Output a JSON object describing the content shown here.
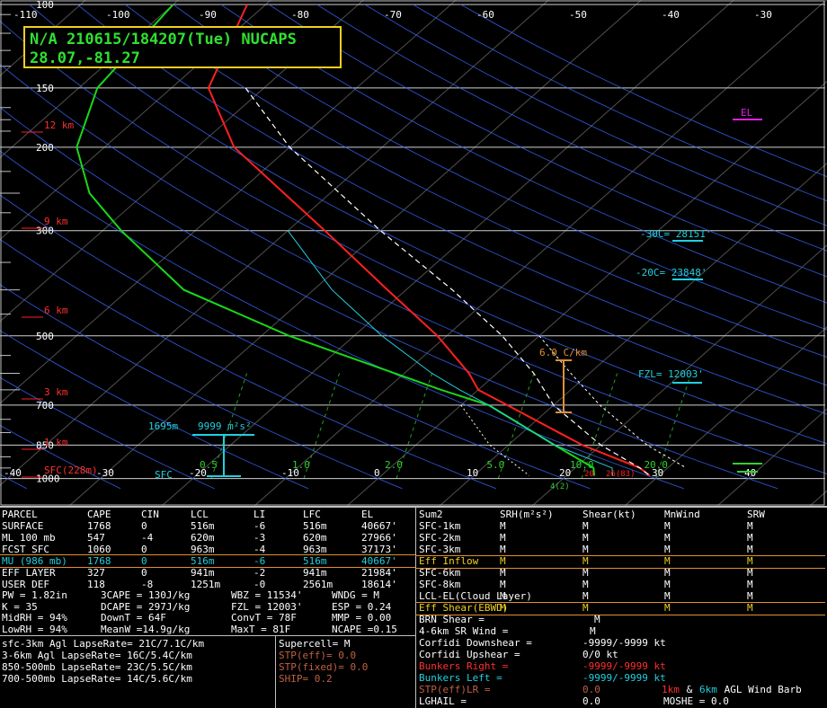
{
  "title": {
    "line1": "N/A 210615/184207(Tue) NUCAPS",
    "line2": "28.07,-81.27"
  },
  "colors": {
    "temp": "#ff2020",
    "dew": "#18d818",
    "isobar": "#ffffff",
    "isotherm": "#3a66ff",
    "parcel": "#ffffff",
    "cyan": "#20d0e0",
    "orange": "#e09030",
    "magenta": "#e020e0",
    "green": "#30d030"
  },
  "chart_data": {
    "type": "skew-t",
    "temp_ticks_top": [
      "-110",
      "-100",
      "-90",
      "-80",
      "-70",
      "-60",
      "-50",
      "-40",
      "-30"
    ],
    "temp_ticks_bottom": [
      "-40",
      "-30",
      "-20",
      "-10",
      "0",
      "10",
      "20",
      "30",
      "40"
    ],
    "pressure_labels": [
      "100",
      "150",
      "200",
      "300",
      "500",
      "700",
      "850",
      "1000"
    ],
    "height_labels": [
      "12 km",
      "9 km",
      "6 km",
      "3 km",
      "1 km",
      "SFC(228m)"
    ],
    "mixing_ratio_labels": [
      "0.5",
      "1.0",
      "2.0",
      "5.0",
      "10.0",
      "20.0"
    ],
    "temperature_profile_pressure_hPa": [
      100,
      150,
      200,
      250,
      300,
      400,
      500,
      600,
      650,
      700,
      850,
      950,
      986
    ],
    "temperature_profile_degC": [
      -72,
      -66,
      -56,
      -45,
      -36,
      -22,
      -11,
      -3,
      0,
      5,
      18,
      27,
      29
    ],
    "dewpoint_profile_pressure_hPa": [
      100,
      150,
      200,
      250,
      300,
      400,
      500,
      600,
      650,
      700,
      850,
      950,
      986
    ],
    "dewpoint_profile_degC": [
      -80,
      -78,
      -73,
      -66,
      -58,
      -44,
      -27,
      -11,
      -4,
      3,
      15,
      22,
      23
    ],
    "annotations": {
      "lapse": "6.0 C/km",
      "el": "EL",
      "m30": "-30C= 28151'",
      "m20": "-20C= 23848'",
      "fzl": "FZL= 12003'",
      "srh_height": "1695m",
      "srh": "9999 m²s²",
      "sfc": "SFC",
      "sfc_temp": "20",
      "sfc_dew": "26(83)",
      "sfc_vt": "4(2)"
    }
  },
  "parcel_table": {
    "headers": [
      "PARCEL",
      "CAPE",
      "CIN",
      "LCL",
      "LI",
      "LFC",
      "EL"
    ],
    "rows": [
      [
        "SURFACE",
        "1768",
        "0",
        "516m",
        "-6",
        "516m",
        "40667'"
      ],
      [
        "ML 100 mb",
        "547",
        "-4",
        "620m",
        "-3",
        "620m",
        "27966'"
      ],
      [
        "FCST SFC",
        "1060",
        "0",
        "963m",
        "-4",
        "963m",
        "37173'"
      ],
      [
        "MU (986 mb)",
        "1768",
        "0",
        "516m",
        "-6",
        "516m",
        "40667'"
      ],
      [
        "EFF LAYER",
        "327",
        "0",
        "941m",
        "-2",
        "941m",
        "21984'"
      ],
      [
        "USER DEF",
        "118",
        "-8",
        "1251m",
        "-0",
        "2561m",
        "18614'"
      ]
    ]
  },
  "indices": {
    "rows": [
      [
        "PW = 1.82in",
        "3CAPE = 130J/kg",
        "WBZ = 11534'",
        "WNDG = M"
      ],
      [
        "K = 35",
        "DCAPE = 297J/kg",
        "FZL = 12003'",
        "ESP = 0.24"
      ],
      [
        "MidRH = 94%",
        "DownT = 64F",
        "ConvT = 78F",
        "MMP = 0.00"
      ],
      [
        "LowRH = 94%",
        "MeanW =14.9g/kg",
        "MaxT = 81F",
        "NCAPE =0.15"
      ]
    ]
  },
  "lapse_rates": [
    "sfc-3km Agl LapseRate= 21C/7.1C/km",
    "3-6km Agl LapseRate= 16C/5.4C/km",
    "850-500mb LapseRate= 23C/5.5C/km",
    "700-500mb LapseRate= 14C/5.6C/km"
  ],
  "composite": {
    "supercell": "Supercell= M",
    "stp_eff": "STP(eff)= 0.0",
    "stp_fixed": "STP(fixed)= 0.0",
    "ship": "SHIP= 0.2"
  },
  "shear_table": {
    "headers": [
      "Sum2",
      "SRH(m²s²)",
      "Shear(kt)",
      "MnWind",
      "SRW"
    ],
    "rows": [
      [
        "SFC-1km",
        "M",
        "M",
        "M",
        "M"
      ],
      [
        "SFC-2km",
        "M",
        "M",
        "M",
        "M"
      ],
      [
        "SFC-3km",
        "M",
        "M",
        "M",
        "M"
      ],
      [
        "Eff Inflow",
        "M",
        "M",
        "M",
        "M"
      ],
      [
        "SFC-6km",
        "M",
        "M",
        "M",
        "M"
      ],
      [
        "SFC-8km",
        "M",
        "M",
        "M",
        "M"
      ],
      [
        "LCL-EL(Cloud Layer)",
        "M",
        "M",
        "M",
        "M"
      ],
      [
        "Eff Shear(EBWD)",
        "M",
        "M",
        "M",
        "M"
      ]
    ]
  },
  "motion": {
    "brn_label": "BRN Shear =",
    "brn_val": "M",
    "sr46_label": "4-6km SR Wind =",
    "sr46_val": "M",
    "cdown_label": "Corfidi Downshear =",
    "cdown_val": "-9999/-9999 kt",
    "cup_label": "Corfidi Upshear =",
    "cup_val": "0/0 kt",
    "bright_label": "Bunkers Right =",
    "bright_val": "-9999/-9999 kt",
    "bleft_label": "Bunkers Left =",
    "bleft_val": "-9999/-9999 kt",
    "stplr_label": "STP(eff)LR =",
    "stplr_val": "0.0",
    "lghail_label": "LGHAIL =",
    "lghail_val": "0.0",
    "barb_1km": "1km",
    "barb_and": " & ",
    "barb_6km": "6km",
    "barb_rest": " AGL Wind Barb",
    "moshe": "MOSHE = 0.0"
  }
}
